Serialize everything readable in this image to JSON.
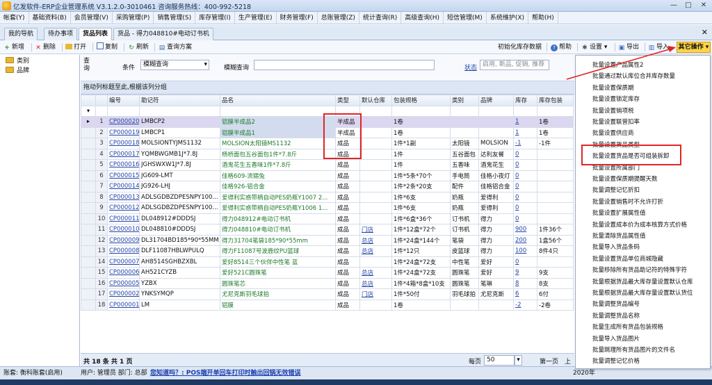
{
  "window": {
    "title": "亿发软件-ERP企业管理系统 V3.1.2.0-3010461 咨询服务热线：400-992-5218",
    "controls": [
      "—",
      "□",
      "✕"
    ]
  },
  "menubar": [
    "帐套(Y)",
    "基础资料(B)",
    "会员管理(V)",
    "采购管理(P)",
    "销售管理(S)",
    "库存管理(I)",
    "生产管理(E)",
    "财务管理(F)",
    "总账管理(Z)",
    "统计查询(R)",
    "高级查询(H)",
    "短信管理(M)",
    "系统维护(X)",
    "帮助(H)"
  ],
  "tabs": [
    "我的导航",
    "待办事项",
    "货品列表",
    "货品 - 得力048810#电动订书机"
  ],
  "toolbar": {
    "new": "新增",
    "delete": "删除",
    "open": "打开",
    "copy": "复制",
    "refresh": "刷新",
    "query_plan": "查询方案",
    "init_stock": "初始化库存数据",
    "help": "帮助",
    "settings": "设置",
    "export": "导出",
    "import": "导入",
    "other_ops": "其它操作"
  },
  "tree": [
    "类别",
    "品牌"
  ],
  "query": {
    "label_query": "查询",
    "condition_label": "条件",
    "condition_value": "模糊查询",
    "fuzzy_label": "模糊查询",
    "status_label": "状态",
    "status_placeholder": "启用, 新品, 促销, 推荐"
  },
  "group_hint": "拖动列标题至此,根据该列分组",
  "grid": {
    "columns": [
      "编号",
      "助记符",
      "品名",
      "类型",
      "默认仓库",
      "包装规格",
      "类别",
      "品牌",
      "库存",
      "库存包装"
    ],
    "rows": [
      {
        "n": "1",
        "code": "CP000020",
        "mnemonic": "LMBCP2",
        "name": "铝膜半成品2",
        "type": "半成品",
        "wh": "",
        "pack": "1卷",
        "cat": "",
        "brand": "",
        "stock": "1",
        "spack": "1卷"
      },
      {
        "n": "2",
        "code": "CP000019",
        "mnemonic": "LMBCP1",
        "name": "铝膜半成品1",
        "type": "半成品",
        "wh": "",
        "pack": "1卷",
        "cat": "",
        "brand": "",
        "stock": "1",
        "spack": "1卷"
      },
      {
        "n": "3",
        "code": "CP000018",
        "mnemonic": "MOLSIONTYJMS1132",
        "name": "MOLSION太阳镜MS1132",
        "type": "成品",
        "wh": "",
        "pack": "1件*1副",
        "cat": "太阳镜",
        "brand": "MOLSION",
        "stock": "-1",
        "spack": "-1件"
      },
      {
        "n": "4",
        "code": "CP000017",
        "mnemonic": "YQMBWGMB1J*7.8J",
        "name": "杨桥面包五谷面包1件*7.8斤",
        "type": "成品",
        "wh": "",
        "pack": "1件",
        "cat": "五谷面包",
        "brand": "达利友餐",
        "stock": "0",
        "spack": ""
      },
      {
        "n": "5",
        "code": "CP000016",
        "mnemonic": "JGHSWXW1J*7.8J",
        "name": "酒鬼花生五香味1件*7.8斤",
        "type": "成品",
        "wh": "",
        "pack": "1件",
        "cat": "五香味",
        "brand": "酒鬼花生",
        "stock": "0",
        "spack": ""
      },
      {
        "n": "6",
        "code": "CP000015",
        "mnemonic": "JG609-LMT",
        "name": "佳格609-流锡兔",
        "type": "成品",
        "wh": "",
        "pack": "1件*5条*70个",
        "cat": "手电筒",
        "brand": "佳格小夜灯",
        "stock": "0",
        "spack": ""
      },
      {
        "n": "7",
        "code": "CP000014",
        "mnemonic": "JG926-LHJ",
        "name": "佳格926-铝合金",
        "type": "成品",
        "wh": "",
        "pack": "1件*2条*20支",
        "cat": "配件",
        "brand": "佳格铝合金",
        "stock": "0",
        "spack": ""
      },
      {
        "n": "8",
        "code": "CP000013",
        "mnemonic": "ADLSGDBZDPESNPY100...",
        "name": "爱得利实惑带柄自动PES奶瓶Y1007 2...",
        "type": "成品",
        "wh": "",
        "pack": "1件*6支",
        "cat": "奶瓶",
        "brand": "爱得利",
        "stock": "0",
        "spack": ""
      },
      {
        "n": "9",
        "code": "CP000012",
        "mnemonic": "ADLSGDBZDPESNPY100...",
        "name": "爱得利实惑带柄自动PES奶瓶Y1006 1...",
        "type": "成品",
        "wh": "",
        "pack": "1件*6支",
        "cat": "奶瓶",
        "brand": "爱得利",
        "stock": "0",
        "spack": ""
      },
      {
        "n": "10",
        "code": "CP000011",
        "mnemonic": "DL048912#DDDSJ",
        "name": "得力048912#电动订书机",
        "type": "成品",
        "wh": "",
        "pack": "1件*6盒*36个",
        "cat": "订书机",
        "brand": "得力",
        "stock": "0",
        "spack": ""
      },
      {
        "n": "11",
        "code": "CP000010",
        "mnemonic": "DL048810#DDDSJ",
        "name": "得力048810#电动订书机",
        "type": "成品",
        "wh": "门店",
        "pack": "1件*12盒*72个",
        "cat": "订书机",
        "brand": "得力",
        "stock": "900",
        "spack": "1件36个"
      },
      {
        "n": "12",
        "code": "CP000009",
        "mnemonic": "DL31704BD185*90*55MM",
        "name": "得力31704笔袋185*90*55mm",
        "type": "成品",
        "wh": "总店",
        "pack": "1件*24盒*144个",
        "cat": "笔袋",
        "brand": "得力",
        "stock": "200",
        "spack": "1盒56个"
      },
      {
        "n": "13",
        "code": "CP000008",
        "mnemonic": "DLF11087HBLWPULQ",
        "name": "得力F11087号波鹿纹PU篮球",
        "type": "成品",
        "wh": "总店",
        "pack": "1件*12只",
        "cat": "皮篮球",
        "brand": "得力",
        "stock": "100",
        "spack": "8件4只"
      },
      {
        "n": "14",
        "code": "CP000007",
        "mnemonic": "AH8514SGHBZXBL",
        "name": "爱好8514三个伙伴中性笔 蓝",
        "type": "成品",
        "wh": "",
        "pack": "1件*24盒*72支",
        "cat": "中性笔",
        "brand": "爱好",
        "stock": "0",
        "spack": ""
      },
      {
        "n": "15",
        "code": "CP000006",
        "mnemonic": "AH521CYZB",
        "name": "爱好521C圆珠笔",
        "type": "成品",
        "wh": "总店",
        "pack": "1件*24盒*72支",
        "cat": "圆珠笔",
        "brand": "爱好",
        "stock": "9",
        "spack": "9支"
      },
      {
        "n": "16",
        "code": "CP000005",
        "mnemonic": "YZBX",
        "name": "圆珠笔芯",
        "type": "成品",
        "wh": "总店",
        "pack": "1件*4箱*8盒*10支",
        "cat": "圆珠笔",
        "brand": "笔琳",
        "stock": "8",
        "spack": "8支"
      },
      {
        "n": "17",
        "code": "CP000002",
        "mnemonic": "YNKSYMQP",
        "name": "尤尼克斯羽毛球拍",
        "type": "成品",
        "wh": "门店",
        "pack": "1件*50付",
        "cat": "羽毛球拍",
        "brand": "尤尼克斯",
        "stock": "6",
        "spack": "6付"
      },
      {
        "n": "18",
        "code": "CP000001",
        "mnemonic": "LM",
        "name": "铝膜",
        "type": "成品",
        "wh": "",
        "pack": "1卷",
        "cat": "",
        "brand": "",
        "stock": "-2",
        "spack": "-2卷"
      }
    ]
  },
  "footer": {
    "summary": "共 18 条  共 1 页",
    "per_page_label": "每页",
    "per_page": "50",
    "first": "第一页",
    "prev": "上"
  },
  "statusbar": {
    "account": "账套: 衡科账套(启用)",
    "user": "用户: 管理员  部门: 总部",
    "tip": "您知道吗？: POS端开单回车打印时触出回锅无效错误",
    "date": "2020年"
  },
  "dropdown": [
    "批量设置产品属性2",
    "批量通过默认库位合并库存数量",
    "批量设置保质期",
    "批量设置锁定库存",
    "批量设置销项税",
    "批量设置联营扣率",
    "批量设置供应商",
    "批量设置货品类型",
    "批量设置货品是否可组装拆卸",
    "批量设置所属部门",
    "批量设置保质期提醒天数",
    "批量调整记忆折扣",
    "批量设置销售时不允许打折",
    "批量设置扩展属性值",
    "批量设置成本价为成本核算方式价格",
    "批量清除货品属性值",
    "批量导入货品条码",
    "批量设置货品单位商城隐藏",
    "批量移除所有货品助记符的特殊字符",
    "批量根据货品最大库存量设置默认仓库",
    "批量根据货品最大库存量设置默认货位",
    "批量调整货品编号",
    "批量调整货品名称",
    "批量生成所有货品包装规格",
    "批量导入货品图片",
    "批量跳理所有货品图片的文件名",
    "批量调整记忆价格"
  ],
  "colors": {
    "accent": "#ffd34a",
    "highlight": "#e02424",
    "link": "#2545a8",
    "selected_row": "#dcd6f0"
  }
}
